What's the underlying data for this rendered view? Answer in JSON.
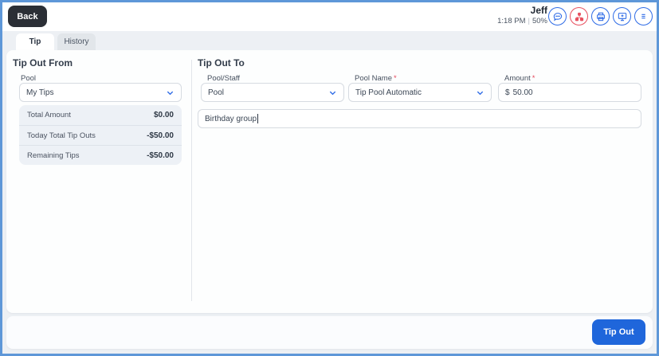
{
  "header": {
    "back_label": "Back",
    "user_name": "Jeff",
    "time": "1:18 PM",
    "separator": "|",
    "battery": "50%",
    "icons": [
      "chat-icon",
      "network-icon",
      "printer-icon",
      "display-icon",
      "menu-icon"
    ]
  },
  "tabs": [
    {
      "label": "Tip",
      "active": true
    },
    {
      "label": "History",
      "active": false
    }
  ],
  "tip_out_from": {
    "title": "Tip Out From",
    "pool_label": "Pool",
    "pool_value": "My Tips",
    "summary": [
      {
        "label": "Total Amount",
        "value": "$0.00"
      },
      {
        "label": "Today Total Tip Outs",
        "value": "-$50.00"
      },
      {
        "label": "Remaining Tips",
        "value": "-$50.00"
      }
    ]
  },
  "tip_out_to": {
    "title": "Tip Out To",
    "pool_staff_label": "Pool/Staff",
    "pool_staff_value": "Pool",
    "pool_name_label": "Pool Name",
    "pool_name_required": "*",
    "pool_name_value": "Tip Pool Automatic",
    "amount_label": "Amount",
    "amount_required": "*",
    "amount_prefix": "$",
    "amount_value": "50.00",
    "note_value": "Birthday group"
  },
  "footer": {
    "tip_out_label": "Tip Out"
  },
  "colors": {
    "accent_blue": "#1f66db",
    "icon_blue": "#2e6be6",
    "alert_red": "#e8505f",
    "window_border": "#5e97d8",
    "page_bg": "#edf0f4",
    "summary_bg": "#edf1f6",
    "dark_button": "#2b2f36"
  }
}
